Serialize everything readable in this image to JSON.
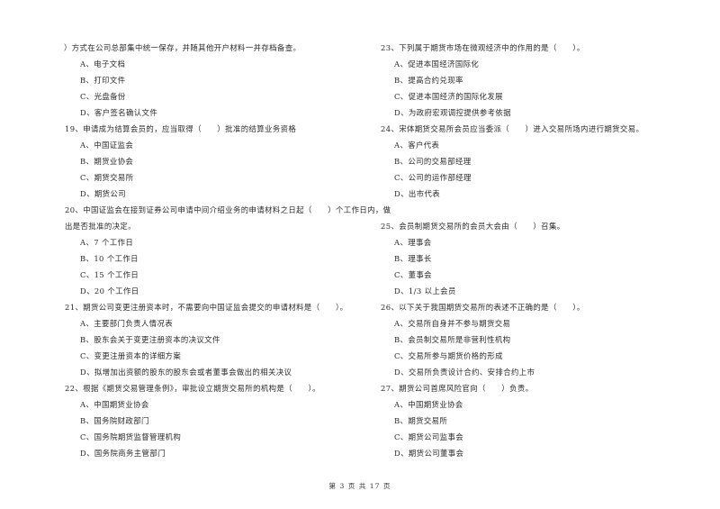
{
  "left_column": {
    "continuation": {
      "text": "）方式在公司总部集中统一保存，并随其他开户材料一并存档备查。",
      "options": [
        "A、电子文档",
        "B、打印文件",
        "C、光盘备份",
        "D、客户签名确认文件"
      ]
    },
    "questions": [
      {
        "number": "19",
        "text": "19、申请成为结算会员的，应当取得（　　）批准的结算业务资格",
        "options": [
          "A、中国证监会",
          "B、期货业协会",
          "C、期货交易所",
          "D、期货公司"
        ]
      },
      {
        "number": "20",
        "text": "20、中国证监会在接到证券公司申请中间介绍业务的申请材料之日起（　　）个工作日内，做",
        "text_cont": "出是否批准的决定。",
        "options": [
          "A、7 个工作日",
          "B、10 个工作日",
          "C、15 个工作日",
          "D、20 个工作日"
        ]
      },
      {
        "number": "21",
        "text": "21、期货公司变更注册资本时，不需要向中国证监会提交的申请材料是（　　）。",
        "options": [
          "A、主要部门负责人情况表",
          "B、股东会关于变更注册资本的决议文件",
          "C、变更注册资本的详细方案",
          "D、拟增加出资额的股东的股东会或者董事会做出的相关决议"
        ]
      },
      {
        "number": "22",
        "text": "22、根据《期货交易管理条例》，审批设立期货交易所的机构是（　　）。",
        "options": [
          "A、中国期货业协会",
          "B、国务院财政部门",
          "C、国务院期货监督管理机构",
          "D、国务院商务主管部门"
        ]
      }
    ]
  },
  "right_column": {
    "questions": [
      {
        "number": "23",
        "text": "23、下列属于期货市场在微观经济中的作用的是（　　）。",
        "options": [
          "A、促进本国经济国际化",
          "B、提高合约兑现率",
          "C、促进本国经济的国际化发展",
          "D、为政府宏观调控提供参考依据"
        ]
      },
      {
        "number": "24",
        "text": "24、宋体期货交易所会员应当委派（　　）进入交易所场内进行期货交易。",
        "options": [
          "A、客户代表",
          "B、公司的交易部经理",
          "C、公司的运作部经理",
          "D、出市代表"
        ]
      },
      {
        "number": "25",
        "text": "25、会员制期货交易所的会员大会由（　　）召集。",
        "options": [
          "A、理事会",
          "B、理事长",
          "C、董事会",
          "D、1/3 以上会员"
        ]
      },
      {
        "number": "26",
        "text": "26、以下关于我国期货交易所的表述不正确的是（　　）。",
        "options": [
          "A、交易所自身并不参与期货交易",
          "B、会员制交易所是非营利性机构",
          "C、交易所参与期货价格的形成",
          "D、交易所负责设计合约、安排合约上市"
        ]
      },
      {
        "number": "27",
        "text": "27、期货公司首席风险官向（　　）负责。",
        "options": [
          "A、中国期货业协会",
          "B、期货交易所",
          "C、期货公司监事会",
          "D、期货公司董事会"
        ]
      }
    ]
  },
  "footer": {
    "page_label": "第 3 页 共 17 页"
  }
}
